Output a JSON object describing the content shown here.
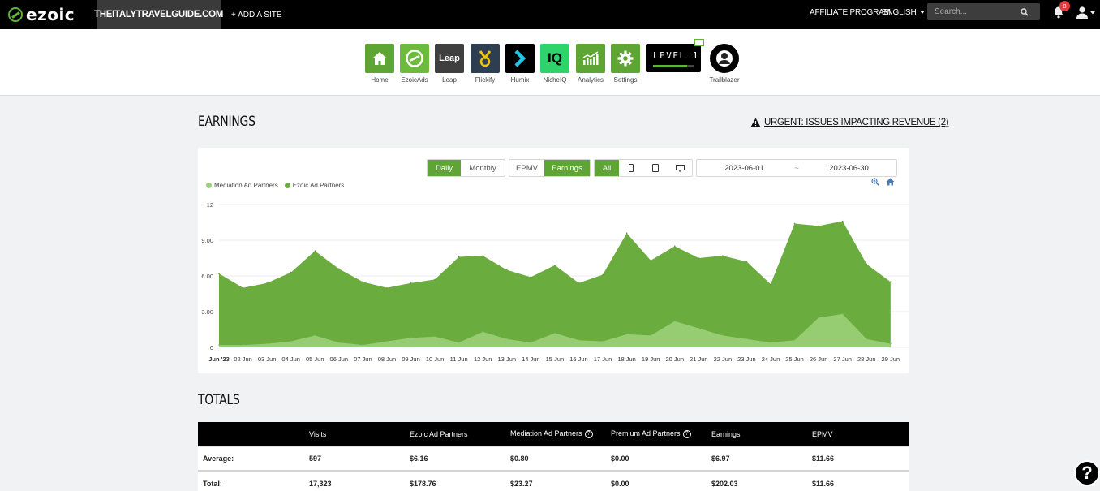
{
  "topbar": {
    "logo": "ezoic",
    "site_name": "THEITALYTRAVELGUIDE.COM",
    "add_site": "+ ADD A SITE",
    "affiliate": "AFFILIATE PROGRAM",
    "language": "ENGLISH",
    "search_placeholder": "Search...",
    "notification_count": "8"
  },
  "apps": [
    {
      "label": "Home",
      "icon": "home-icon",
      "color": "#5fa535"
    },
    {
      "label": "EzoicAds",
      "icon": "ezoic-ads-icon",
      "color": "#6dbb3c"
    },
    {
      "label": "Leap",
      "icon": "leap-icon",
      "color": "#3f3f3f",
      "text": "Leap"
    },
    {
      "label": "Flickify",
      "icon": "flickify-icon",
      "color": "#2c3e50"
    },
    {
      "label": "Humix",
      "icon": "humix-icon",
      "color": "#000000"
    },
    {
      "label": "NicheIQ",
      "icon": "nicheiq-icon",
      "color": "#2fd36b",
      "text": "IQ"
    },
    {
      "label": "Analytics",
      "icon": "analytics-icon",
      "color": "#5fa535"
    },
    {
      "label": "Settings",
      "icon": "settings-icon",
      "color": "#5fa535"
    }
  ],
  "level": {
    "text": "LEVEL 1",
    "progress": 0.84
  },
  "trailblazer": {
    "label": "Trailblazer"
  },
  "earnings": {
    "title": "EARNINGS",
    "urgent": "URGENT: ISSUES IMPACTING REVENUE (2)"
  },
  "controls": {
    "daily": "Daily",
    "monthly": "Monthly",
    "epmv": "EPMV",
    "earnings": "Earnings",
    "all": "All",
    "start_date": "2023-06-01",
    "date_sep": "~",
    "end_date": "2023-06-30"
  },
  "chart_data": {
    "type": "area",
    "stacked": true,
    "legend_position": "top-left",
    "grid": true,
    "categories": [
      "Jun '23",
      "02 Jun",
      "03 Jun",
      "04 Jun",
      "05 Jun",
      "06 Jun",
      "07 Jun",
      "08 Jun",
      "09 Jun",
      "10 Jun",
      "11 Jun",
      "12 Jun",
      "13 Jun",
      "14 Jun",
      "15 Jun",
      "16 Jun",
      "17 Jun",
      "18 Jun",
      "19 Jun",
      "20 Jun",
      "21 Jun",
      "22 Jun",
      "23 Jun",
      "24 Jun",
      "25 Jun",
      "26 Jun",
      "27 Jun",
      "28 Jun",
      "29 Jun"
    ],
    "y_ticks": [
      "0",
      "3.00",
      "6.00",
      "9.00",
      "12"
    ],
    "ylim": [
      0,
      12
    ],
    "series": [
      {
        "name": "Mediation Ad Partners",
        "color": "#9bcf78",
        "values": [
          0.2,
          0.2,
          0.3,
          0.5,
          1.0,
          0.4,
          0.2,
          0.5,
          0.8,
          0.9,
          0.4,
          1.3,
          0.7,
          0.4,
          1.2,
          0.6,
          0.5,
          1.1,
          1.0,
          2.2,
          1.6,
          1.0,
          0.7,
          0.4,
          0.6,
          2.5,
          2.8,
          0.7,
          0.3
        ]
      },
      {
        "name": "Ezoic Ad Partners",
        "color": "#6aad3e",
        "values": [
          6.0,
          4.8,
          5.1,
          5.8,
          7.1,
          6.2,
          5.3,
          4.5,
          4.6,
          4.8,
          7.2,
          6.4,
          5.8,
          5.5,
          5.7,
          4.8,
          5.6,
          8.5,
          6.3,
          6.3,
          5.9,
          6.7,
          6.5,
          4.9,
          9.8,
          7.7,
          7.8,
          6.3,
          5.2
        ]
      }
    ]
  },
  "totals": {
    "title": "TOTALS",
    "headers": [
      "",
      "Visits",
      "Ezoic Ad Partners",
      "Mediation Ad Partners",
      "Premium Ad Partners",
      "Earnings",
      "EPMV"
    ],
    "rows": [
      [
        "Average:",
        "597",
        "$6.16",
        "$0.80",
        "$0.00",
        "$6.97",
        "$11.66"
      ],
      [
        "Total:",
        "17,323",
        "$178.76",
        "$23.27",
        "$0.00",
        "$202.03",
        "$11.66"
      ]
    ]
  },
  "help_fab": "?"
}
